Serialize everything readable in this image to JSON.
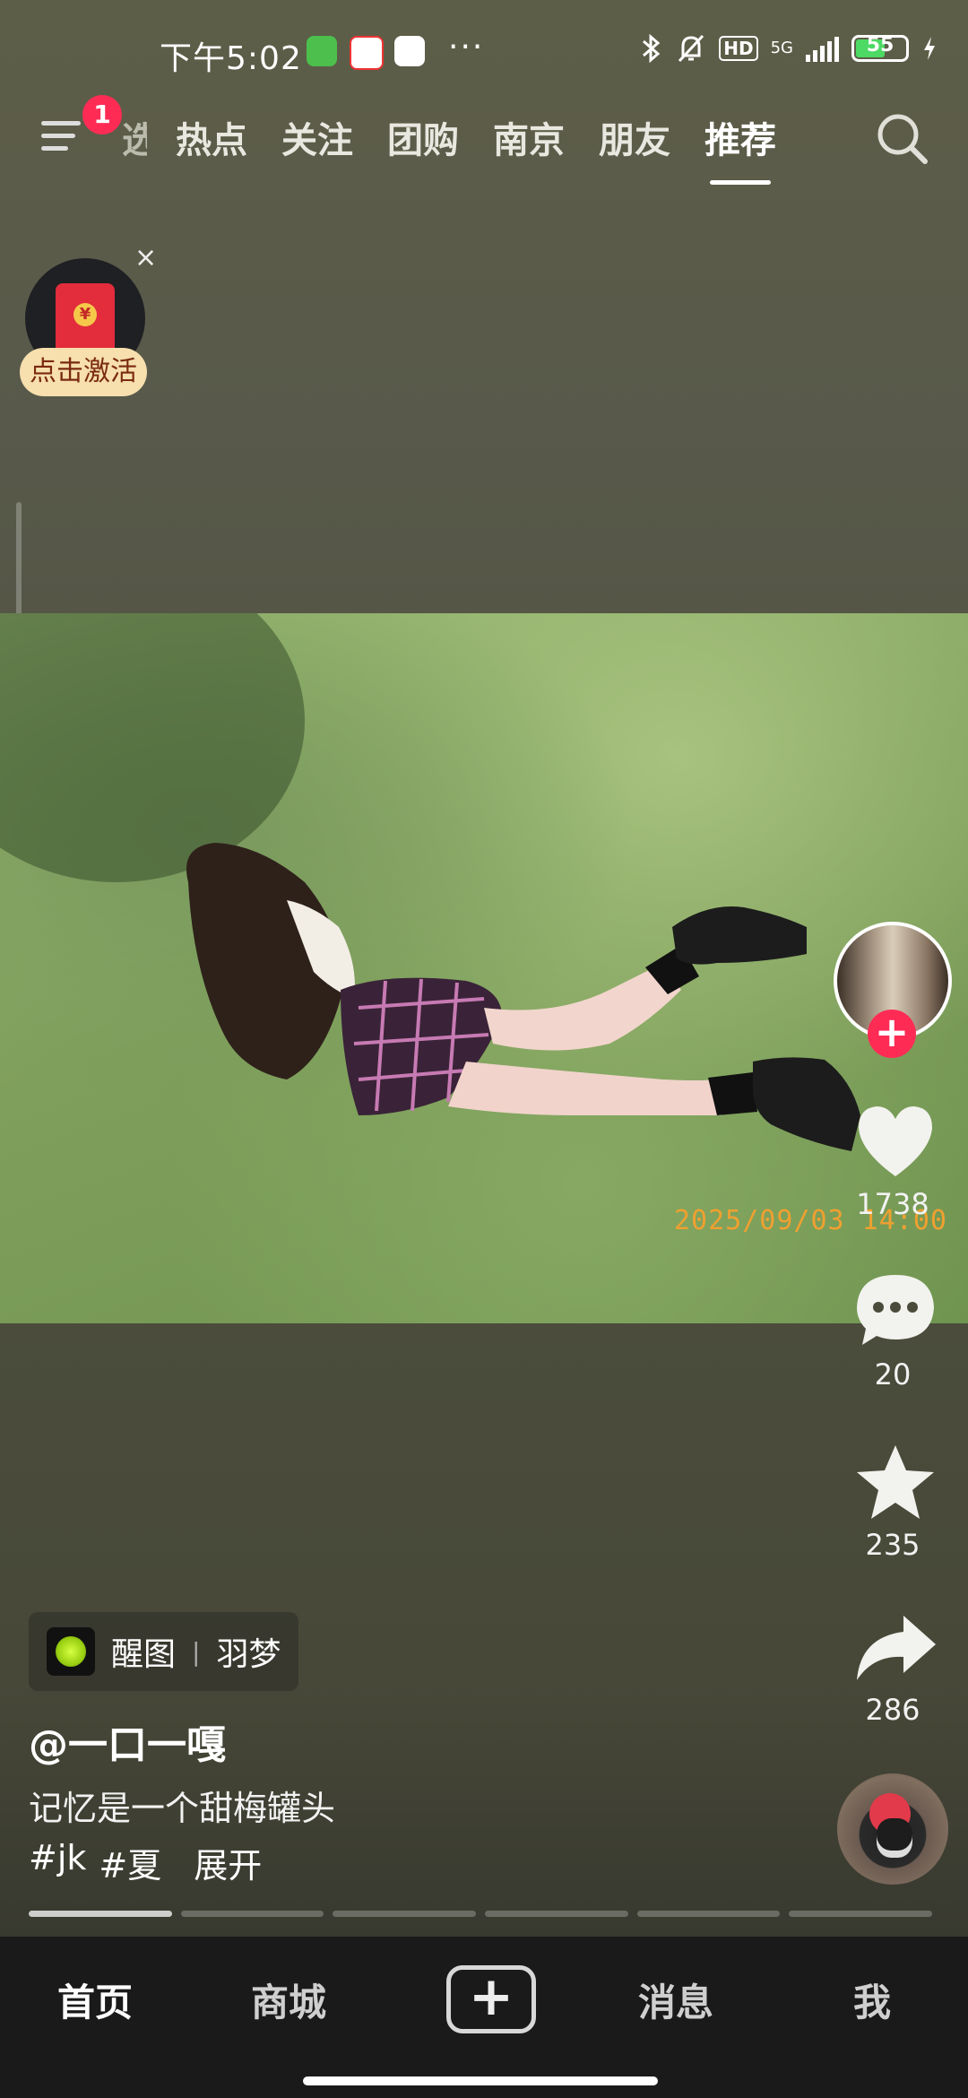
{
  "status": {
    "time": "下午5:02",
    "network": "5G",
    "hd": "HD",
    "battery": "55",
    "dots": "···"
  },
  "topnav": {
    "badge": "1",
    "tabs": [
      {
        "label": "选"
      },
      {
        "label": "热点"
      },
      {
        "label": "关注"
      },
      {
        "label": "团购"
      },
      {
        "label": "南京"
      },
      {
        "label": "朋友"
      },
      {
        "label": "推荐",
        "active": true
      }
    ]
  },
  "redpacket": {
    "label": "点击激活",
    "close": "×"
  },
  "photo": {
    "timestamp": "2025/09/03 14:00"
  },
  "rail": {
    "likes": "1738",
    "comments": "20",
    "favorites": "235",
    "shares": "286",
    "follow": "+"
  },
  "post": {
    "effect_app": "醒图",
    "effect_name": "羽梦",
    "effect_sep": "|",
    "author": "@一口一嘎",
    "caption": "记忆是一个甜梅罐头",
    "tags": [
      "#jk",
      "#夏"
    ],
    "more": "展开"
  },
  "bottom": {
    "home": "首页",
    "mall": "商城",
    "plus": "+",
    "messages": "消息",
    "me": "我"
  },
  "colors": {
    "accent": "#fe2c55",
    "timestamp": "#f0a030"
  }
}
